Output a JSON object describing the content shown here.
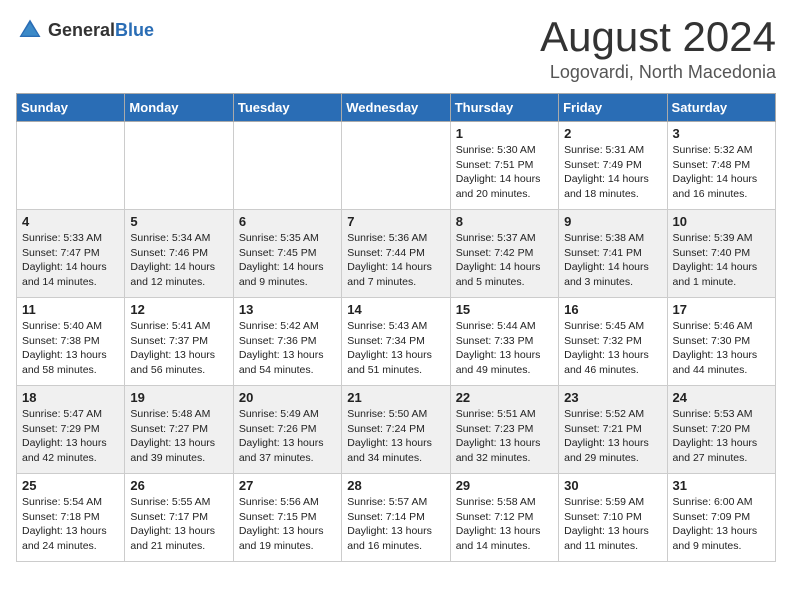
{
  "header": {
    "logo_general": "General",
    "logo_blue": "Blue",
    "month_year": "August 2024",
    "location": "Logovardi, North Macedonia"
  },
  "weekdays": [
    "Sunday",
    "Monday",
    "Tuesday",
    "Wednesday",
    "Thursday",
    "Friday",
    "Saturday"
  ],
  "weeks": [
    {
      "days": [
        {
          "num": "",
          "info": ""
        },
        {
          "num": "",
          "info": ""
        },
        {
          "num": "",
          "info": ""
        },
        {
          "num": "",
          "info": ""
        },
        {
          "num": "1",
          "info": "Sunrise: 5:30 AM\nSunset: 7:51 PM\nDaylight: 14 hours\nand 20 minutes."
        },
        {
          "num": "2",
          "info": "Sunrise: 5:31 AM\nSunset: 7:49 PM\nDaylight: 14 hours\nand 18 minutes."
        },
        {
          "num": "3",
          "info": "Sunrise: 5:32 AM\nSunset: 7:48 PM\nDaylight: 14 hours\nand 16 minutes."
        }
      ]
    },
    {
      "days": [
        {
          "num": "4",
          "info": "Sunrise: 5:33 AM\nSunset: 7:47 PM\nDaylight: 14 hours\nand 14 minutes."
        },
        {
          "num": "5",
          "info": "Sunrise: 5:34 AM\nSunset: 7:46 PM\nDaylight: 14 hours\nand 12 minutes."
        },
        {
          "num": "6",
          "info": "Sunrise: 5:35 AM\nSunset: 7:45 PM\nDaylight: 14 hours\nand 9 minutes."
        },
        {
          "num": "7",
          "info": "Sunrise: 5:36 AM\nSunset: 7:44 PM\nDaylight: 14 hours\nand 7 minutes."
        },
        {
          "num": "8",
          "info": "Sunrise: 5:37 AM\nSunset: 7:42 PM\nDaylight: 14 hours\nand 5 minutes."
        },
        {
          "num": "9",
          "info": "Sunrise: 5:38 AM\nSunset: 7:41 PM\nDaylight: 14 hours\nand 3 minutes."
        },
        {
          "num": "10",
          "info": "Sunrise: 5:39 AM\nSunset: 7:40 PM\nDaylight: 14 hours\nand 1 minute."
        }
      ]
    },
    {
      "days": [
        {
          "num": "11",
          "info": "Sunrise: 5:40 AM\nSunset: 7:38 PM\nDaylight: 13 hours\nand 58 minutes."
        },
        {
          "num": "12",
          "info": "Sunrise: 5:41 AM\nSunset: 7:37 PM\nDaylight: 13 hours\nand 56 minutes."
        },
        {
          "num": "13",
          "info": "Sunrise: 5:42 AM\nSunset: 7:36 PM\nDaylight: 13 hours\nand 54 minutes."
        },
        {
          "num": "14",
          "info": "Sunrise: 5:43 AM\nSunset: 7:34 PM\nDaylight: 13 hours\nand 51 minutes."
        },
        {
          "num": "15",
          "info": "Sunrise: 5:44 AM\nSunset: 7:33 PM\nDaylight: 13 hours\nand 49 minutes."
        },
        {
          "num": "16",
          "info": "Sunrise: 5:45 AM\nSunset: 7:32 PM\nDaylight: 13 hours\nand 46 minutes."
        },
        {
          "num": "17",
          "info": "Sunrise: 5:46 AM\nSunset: 7:30 PM\nDaylight: 13 hours\nand 44 minutes."
        }
      ]
    },
    {
      "days": [
        {
          "num": "18",
          "info": "Sunrise: 5:47 AM\nSunset: 7:29 PM\nDaylight: 13 hours\nand 42 minutes."
        },
        {
          "num": "19",
          "info": "Sunrise: 5:48 AM\nSunset: 7:27 PM\nDaylight: 13 hours\nand 39 minutes."
        },
        {
          "num": "20",
          "info": "Sunrise: 5:49 AM\nSunset: 7:26 PM\nDaylight: 13 hours\nand 37 minutes."
        },
        {
          "num": "21",
          "info": "Sunrise: 5:50 AM\nSunset: 7:24 PM\nDaylight: 13 hours\nand 34 minutes."
        },
        {
          "num": "22",
          "info": "Sunrise: 5:51 AM\nSunset: 7:23 PM\nDaylight: 13 hours\nand 32 minutes."
        },
        {
          "num": "23",
          "info": "Sunrise: 5:52 AM\nSunset: 7:21 PM\nDaylight: 13 hours\nand 29 minutes."
        },
        {
          "num": "24",
          "info": "Sunrise: 5:53 AM\nSunset: 7:20 PM\nDaylight: 13 hours\nand 27 minutes."
        }
      ]
    },
    {
      "days": [
        {
          "num": "25",
          "info": "Sunrise: 5:54 AM\nSunset: 7:18 PM\nDaylight: 13 hours\nand 24 minutes."
        },
        {
          "num": "26",
          "info": "Sunrise: 5:55 AM\nSunset: 7:17 PM\nDaylight: 13 hours\nand 21 minutes."
        },
        {
          "num": "27",
          "info": "Sunrise: 5:56 AM\nSunset: 7:15 PM\nDaylight: 13 hours\nand 19 minutes."
        },
        {
          "num": "28",
          "info": "Sunrise: 5:57 AM\nSunset: 7:14 PM\nDaylight: 13 hours\nand 16 minutes."
        },
        {
          "num": "29",
          "info": "Sunrise: 5:58 AM\nSunset: 7:12 PM\nDaylight: 13 hours\nand 14 minutes."
        },
        {
          "num": "30",
          "info": "Sunrise: 5:59 AM\nSunset: 7:10 PM\nDaylight: 13 hours\nand 11 minutes."
        },
        {
          "num": "31",
          "info": "Sunrise: 6:00 AM\nSunset: 7:09 PM\nDaylight: 13 hours\nand 9 minutes."
        }
      ]
    }
  ]
}
